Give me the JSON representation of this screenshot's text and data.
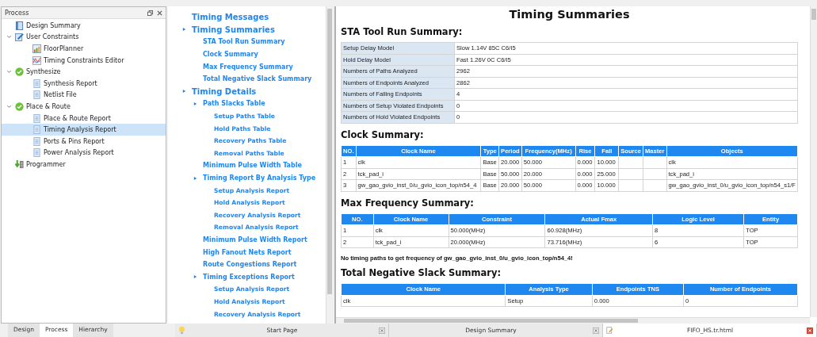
{
  "process_panel": {
    "title": "Process",
    "tree": [
      {
        "label": "Design Summary",
        "kind": "summary",
        "selected": false
      },
      {
        "label": "User Constraints",
        "kind": "constraints",
        "selected": false,
        "expanded": true,
        "children": [
          {
            "label": "FloorPlanner",
            "kind": "floorplanner",
            "selected": false
          },
          {
            "label": "Timing Constraints Editor",
            "kind": "timing-editor",
            "selected": false
          }
        ]
      },
      {
        "label": "Synthesize",
        "kind": "done",
        "selected": false,
        "expanded": true,
        "children": [
          {
            "label": "Synthesis Report",
            "kind": "report",
            "selected": false
          },
          {
            "label": "Netlist File",
            "kind": "report",
            "selected": false
          }
        ]
      },
      {
        "label": "Place & Route",
        "kind": "done",
        "selected": false,
        "expanded": true,
        "children": [
          {
            "label": "Place & Route Report",
            "kind": "report",
            "selected": false
          },
          {
            "label": "Timing Analysis Report",
            "kind": "report",
            "selected": true
          },
          {
            "label": "Ports & Pins Report",
            "kind": "report",
            "selected": false
          },
          {
            "label": "Power Analysis Report",
            "kind": "report",
            "selected": false
          }
        ]
      },
      {
        "label": "Programmer",
        "kind": "programmer",
        "selected": false
      }
    ]
  },
  "panel_tabs": [
    {
      "label": "Design",
      "selected": false
    },
    {
      "label": "Process",
      "selected": true
    },
    {
      "label": "Hierarchy",
      "selected": false
    }
  ],
  "report_nav": [
    {
      "label": "Timing Messages"
    },
    {
      "label": "Timing Summaries",
      "children": [
        {
          "label": "STA Tool Run Summary"
        },
        {
          "label": "Clock Summary"
        },
        {
          "label": "Max Frequency Summary"
        },
        {
          "label": "Total Negative Slack Summary"
        }
      ]
    },
    {
      "label": "Timing Details",
      "children": [
        {
          "label": "Path Slacks Table",
          "children": [
            {
              "label": "Setup Paths Table"
            },
            {
              "label": "Hold Paths Table"
            },
            {
              "label": "Recovery Paths Table"
            },
            {
              "label": "Removal Paths Table"
            }
          ]
        },
        {
          "label": "Minimum Pulse Width Table"
        },
        {
          "label": "Timing Report By Analysis Type",
          "children": [
            {
              "label": "Setup Analysis Report"
            },
            {
              "label": "Hold Analysis Report"
            },
            {
              "label": "Recovery Analysis Report"
            },
            {
              "label": "Removal Analysis Report"
            }
          ]
        },
        {
          "label": "Minimum Pulse Width Report"
        },
        {
          "label": "High Fanout Nets Report"
        },
        {
          "label": "Route Congestions Report"
        },
        {
          "label": "Timing Exceptions Report",
          "children": [
            {
              "label": "Setup Analysis Report"
            },
            {
              "label": "Hold Analysis Report"
            },
            {
              "label": "Recovery Analysis Report"
            }
          ]
        }
      ]
    }
  ],
  "editor_tabs": [
    {
      "label": "Start Page",
      "kind": "bulb",
      "selected": false
    },
    {
      "label": "Design Summary",
      "kind": "plain",
      "selected": false
    },
    {
      "label": "FIFO_HS.tr.html",
      "kind": "document",
      "selected": true
    }
  ],
  "report": {
    "title": "Timing Summaries",
    "sections": [
      {
        "heading": "STA Tool Run Summary:",
        "kind": "properties",
        "rows": [
          [
            "Setup Delay Model",
            "Slow 1.14V 85C C6/I5"
          ],
          [
            "Hold Delay Model",
            "Fast 1.26V 0C C6/I5"
          ],
          [
            "Numbers of Paths Analyzed",
            "2962"
          ],
          [
            "Numbers of Endpoints Analyzed",
            "2862"
          ],
          [
            "Numbers of Falling Endpoints",
            "4"
          ],
          [
            "Numbers of Setup Violated Endpoints",
            "0"
          ],
          [
            "Numbers of Hold Violated Endpoints",
            "0"
          ]
        ]
      },
      {
        "heading": "Clock Summary:",
        "kind": "grid",
        "columns": [
          "NO.",
          "Clock Name",
          "Type",
          "Period",
          "Frequency(MHz)",
          "Rise",
          "Fall",
          "Source",
          "Master",
          "Objects"
        ],
        "rows": [
          [
            "1",
            "clk",
            "Base",
            "20.000",
            "50.000",
            "0.000",
            "10.000",
            "",
            "",
            "clk"
          ],
          [
            "2",
            "tck_pad_i",
            "Base",
            "50.000",
            "20.000",
            "0.000",
            "25.000",
            "",
            "",
            "tck_pad_i"
          ],
          [
            "3",
            "gw_gao_gvio_inst_0/u_gvio_icon_top/n54_4",
            "Base",
            "20.000",
            "50.000",
            "0.000",
            "10.000",
            "",
            "",
            "gw_gao_gvio_inst_0/u_gvio_icon_top/n54_s1/F"
          ]
        ]
      },
      {
        "heading": "Max Frequency Summary:",
        "kind": "grid",
        "columns": [
          "NO.",
          "Clock Name",
          "Constraint",
          "Actual Fmax",
          "Logic Level",
          "Entity"
        ],
        "rows": [
          [
            "1",
            "clk",
            "50.000(MHz)",
            "60.928(MHz)",
            "8",
            "TOP"
          ],
          [
            "2",
            "tck_pad_i",
            "20.000(MHz)",
            "73.716(MHz)",
            "6",
            "TOP"
          ]
        ],
        "note": "No timing paths to get frequency of gw_gao_gvio_inst_0/u_gvio_icon_top/n54_4!"
      },
      {
        "heading": "Total Negative Slack Summary:",
        "kind": "grid",
        "columns": [
          "Clock Name",
          "Analysis Type",
          "Endpoints TNS",
          "Number of Endpoints"
        ],
        "rows": [
          [
            "clk",
            "Setup",
            "0.000",
            "0"
          ]
        ]
      }
    ]
  }
}
